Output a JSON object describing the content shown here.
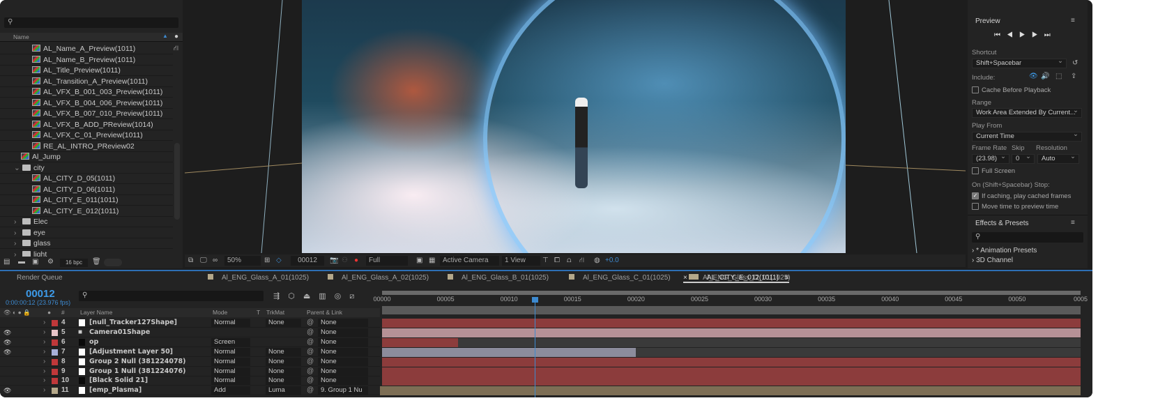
{
  "project": {
    "search_placeholder": "",
    "column_name": "Name",
    "items": [
      {
        "label": "AL_Name_A_Preview(1011)",
        "type": "comp",
        "indent": 2
      },
      {
        "label": "AL_Name_B_Preview(1011)",
        "type": "comp",
        "indent": 2
      },
      {
        "label": "AL_Title_Preview(1011)",
        "type": "comp",
        "indent": 2
      },
      {
        "label": "AL_Transition_A_Preview(1011)",
        "type": "comp",
        "indent": 2
      },
      {
        "label": "AL_VFX_B_001_003_Preview(1011)",
        "type": "comp",
        "indent": 2
      },
      {
        "label": "AL_VFX_B_004_006_Preview(1011)",
        "type": "comp",
        "indent": 2
      },
      {
        "label": "AL_VFX_B_007_010_Preview(1011)",
        "type": "comp",
        "indent": 2
      },
      {
        "label": "AL_VFX_B_ADD_PReview(1014)",
        "type": "comp",
        "indent": 2
      },
      {
        "label": "AL_VFX_C_01_Preview(1011)",
        "type": "comp",
        "indent": 2
      },
      {
        "label": "RE_AL_INTRO_PReview02",
        "type": "comp",
        "indent": 2
      },
      {
        "label": "Al_Jump",
        "type": "comp",
        "indent": 1
      },
      {
        "label": "city",
        "type": "folder",
        "indent": 1,
        "expanded": true
      },
      {
        "label": "AL_CITY_D_05(1011)",
        "type": "comp",
        "indent": 2
      },
      {
        "label": "AL_CITY_D_06(1011)",
        "type": "comp",
        "indent": 2
      },
      {
        "label": "AL_CITY_E_011(1011)",
        "type": "comp",
        "indent": 2
      },
      {
        "label": "AL_CITY_E_012(1011)",
        "type": "comp",
        "indent": 2
      },
      {
        "label": "Elec",
        "type": "folder",
        "indent": 1
      },
      {
        "label": "eye",
        "type": "folder",
        "indent": 1
      },
      {
        "label": "glass",
        "type": "folder",
        "indent": 1
      },
      {
        "label": "light",
        "type": "folder",
        "indent": 1
      }
    ],
    "bpc": "16 bpc"
  },
  "viewer": {
    "zoom": "50%",
    "frame": "00012",
    "resolution": "Full",
    "camera": "Active Camera",
    "views": "1 View",
    "exposure": "+0.0"
  },
  "preview": {
    "title": "Preview",
    "shortcut_label": "Shortcut",
    "shortcut": "Shift+Spacebar",
    "include_label": "Include:",
    "cache_before": "Cache Before Playback",
    "cache_before_checked": false,
    "range_label": "Range",
    "range": "Work Area Extended By Current...",
    "play_from_label": "Play From",
    "play_from": "Current Time",
    "frame_rate_label": "Frame Rate",
    "frame_rate": "(23.98)",
    "skip_label": "Skip",
    "skip": "0",
    "resolution_label": "Resolution",
    "resolution": "Auto",
    "full_screen": "Full Screen",
    "full_screen_checked": false,
    "stop_label": "On (Shift+Spacebar) Stop:",
    "if_caching": "If caching, play cached frames",
    "if_caching_checked": true,
    "move_time": "Move time to preview time",
    "move_time_checked": false
  },
  "effects": {
    "title": "Effects & Presets",
    "items": [
      "* Animation Presets",
      "3D Channel"
    ]
  },
  "timeline": {
    "tabs": [
      "Render Queue",
      "Al_ENG_Glass_A_01(1025)",
      "Al_ENG_Glass_A_02(1025)",
      "Al_ENG_Glass_B_01(1025)",
      "Al_ENG_Glass_C_01(1025)",
      "Al_ENG_Glass_D_01(1025)",
      "AL_CITY_E_012(1011)"
    ],
    "active_tab": "AL_CITY_E_012(1011)",
    "timecode": "00012",
    "timecode_sub": "0:00:00:12 (23.976 fps)",
    "headers": {
      "num": "#",
      "name": "Layer Name",
      "mode": "Mode",
      "t": "T",
      "trkmat": "TrkMat",
      "parent": "Parent & Link"
    },
    "current_frame": 12,
    "duration_frames": 55,
    "ruler": [
      "00000",
      "00005",
      "00010",
      "00015",
      "00020",
      "00025",
      "00030",
      "00035",
      "00040",
      "00045",
      "00050",
      "0005"
    ],
    "layers": [
      {
        "num": "4",
        "name": "[null_Tracker127Shape]",
        "label_color": "#c0383a",
        "visible": false,
        "mode": "Normal",
        "trkmat": "None",
        "parent": "None",
        "bar_color": "#8c3c3c",
        "in": 0,
        "out": 55
      },
      {
        "num": "5",
        "name": "Camera01Shape",
        "label_color": "#e8c4c8",
        "visible": true,
        "mode": "",
        "trkmat": "",
        "parent": "None",
        "bar_color": "#b59196",
        "in": 0,
        "out": 55,
        "camera": true
      },
      {
        "num": "6",
        "name": "op",
        "label_color": "#c0383a",
        "visible": true,
        "mode": "Screen",
        "trkmat": "",
        "parent": "None",
        "bar_color": "#8c3c3c",
        "in": 0,
        "out": 6
      },
      {
        "num": "7",
        "name": "[Adjustment Layer 50]",
        "label_color": "#a8b0d8",
        "visible": true,
        "mode": "Normal",
        "trkmat": "None",
        "parent": "None",
        "bar_color": "#8c8c9c",
        "in": 0,
        "out": 20
      },
      {
        "num": "8",
        "name": "Group 2 Null (381224078)",
        "label_color": "#c0383a",
        "visible": false,
        "mode": "Normal",
        "trkmat": "None",
        "parent": "None",
        "bar_color": "#8c3c3c",
        "in": 0,
        "out": 55
      },
      {
        "num": "9",
        "name": "Group 1 Null (381224076)",
        "label_color": "#c0383a",
        "visible": false,
        "mode": "Normal",
        "trkmat": "None",
        "parent": "None",
        "bar_color": "#8c3c3c",
        "in": 0,
        "out": 55
      },
      {
        "num": "10",
        "name": "[Black Solid 21]",
        "label_color": "#c0383a",
        "visible": false,
        "mode": "Normal",
        "trkmat": "None",
        "parent": "None",
        "bar_color": "#8c3c3c",
        "in": 0,
        "out": 55
      },
      {
        "num": "11",
        "name": "[emp_Plasma]",
        "label_color": "#b5a88a",
        "visible": true,
        "mode": "Add",
        "trkmat": "Luma",
        "parent": "9. Group 1 Nu",
        "bar_color": "#7d6e55",
        "in": 0,
        "out": 55
      }
    ]
  }
}
